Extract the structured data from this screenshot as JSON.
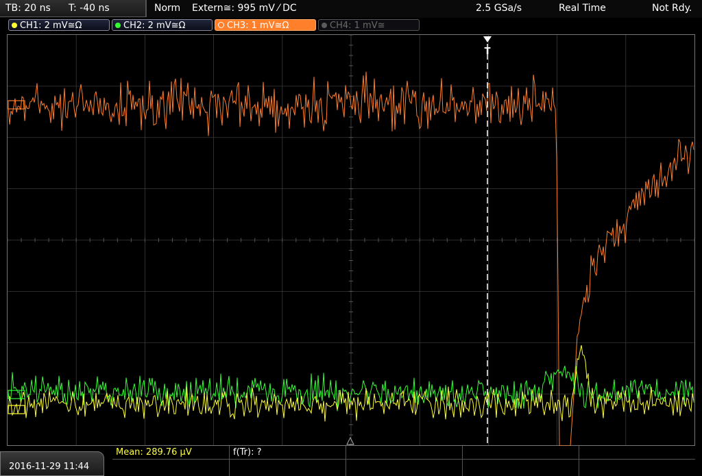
{
  "header": {
    "timebase": "TB: 20 ns",
    "trigger_time": "T: -40 ns",
    "trigger_mode": "Norm",
    "trigger_source": "Extern≅: 995 mV ⁄ DC",
    "sample_rate": "2.5 GSa/s",
    "acquisition": "Real Time",
    "status": "Not Rdy."
  },
  "channels": [
    {
      "label": "CH1: 2 mV≅Ω",
      "color": "#ffff33",
      "active": false,
      "enabled": true
    },
    {
      "label": "CH2: 2 mV≅Ω",
      "color": "#33ff33",
      "active": false,
      "enabled": true
    },
    {
      "label": "CH3: 1 mV≅Ω",
      "color": "#ff7f2a",
      "active": true,
      "enabled": true
    },
    {
      "label": "CH4: 1 mV≅",
      "color": "#5a5a5a",
      "active": false,
      "enabled": false
    }
  ],
  "trigger_marker": "T",
  "footer": {
    "datetime": "2016-11-29 11:44",
    "measurement_1": "Mean: 289.76 µV",
    "measurement_2": "f(Tr): ?"
  },
  "colors": {
    "ch1": "#ffff33",
    "ch2": "#33ff33",
    "ch3": "#ff7f2a",
    "grid": "#3a3a3a",
    "measurement_label": "#ffff44"
  }
}
